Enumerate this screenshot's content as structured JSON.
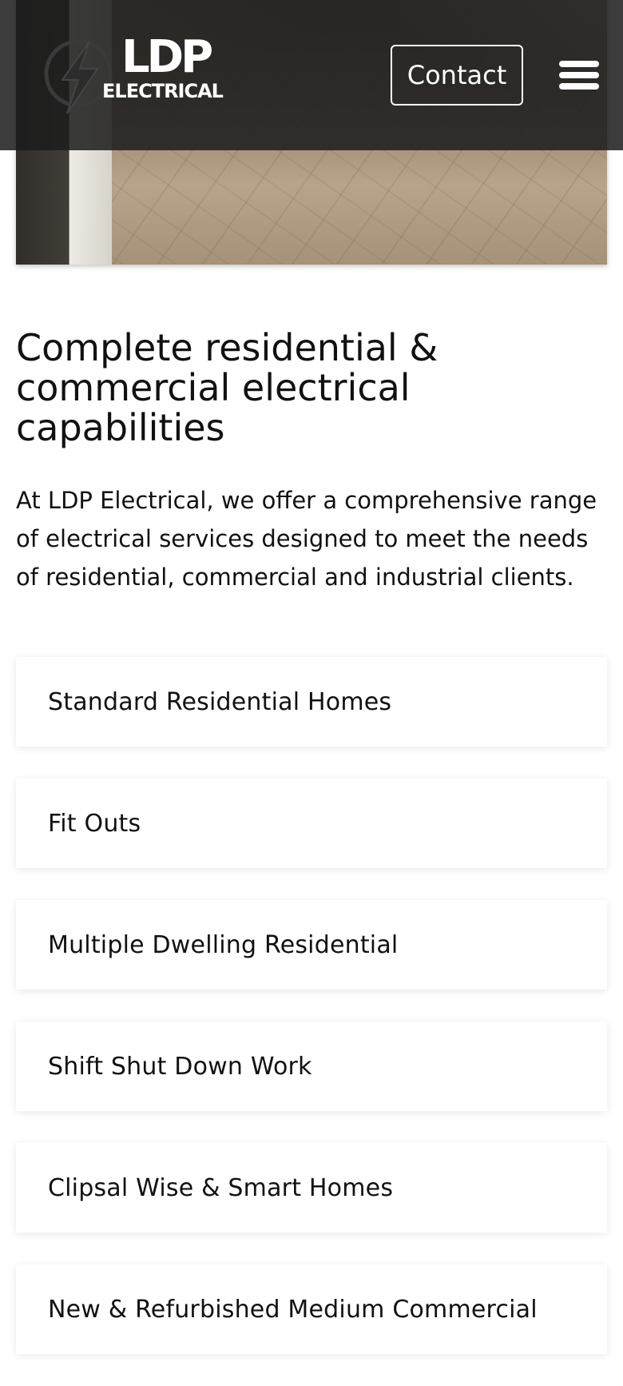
{
  "header": {
    "logo": {
      "main": "LDP",
      "sub": "ELECTRICAL"
    },
    "contact_label": "Contact",
    "menu_icon": "hamburger-menu-icon"
  },
  "main": {
    "title": "Complete residential & commercial electrical capabilities",
    "intro": "At LDP Electrical, we offer a comprehensive range of electrical services designed to meet the needs of residential, commercial and industrial clients.",
    "services": [
      {
        "label": "Standard Residential Homes"
      },
      {
        "label": "Fit Outs"
      },
      {
        "label": "Multiple Dwelling Residential"
      },
      {
        "label": "Shift Shut Down Work"
      },
      {
        "label": "Clipsal Wise & Smart Homes"
      },
      {
        "label": "New & Refurbished Medium Commercial"
      }
    ]
  },
  "colors": {
    "header_bg": "#1c1c1c",
    "text": "#111111",
    "card_bg": "#ffffff"
  }
}
